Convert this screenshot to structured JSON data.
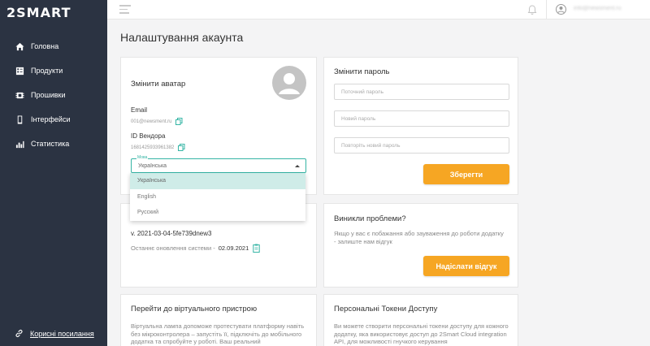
{
  "app": {
    "logo": "2SMART"
  },
  "sidebar": {
    "items": [
      {
        "label": "Головна",
        "icon": "home-icon"
      },
      {
        "label": "Продукти",
        "icon": "products-icon"
      },
      {
        "label": "Прошивки",
        "icon": "firmware-icon"
      },
      {
        "label": "Інтерфейси",
        "icon": "phone-icon"
      },
      {
        "label": "Статистика",
        "icon": "chart-icon"
      }
    ],
    "footer_link": "Корисні посилання"
  },
  "topbar": {
    "user_email": "info@newsment.ru"
  },
  "page": {
    "title": "Налаштування акаунта"
  },
  "account": {
    "avatar_label": "Змінити аватар",
    "email_label": "Email",
    "email_value": "001@newsment.ru",
    "vendor_label": "ID Вендора",
    "vendor_value": "1681425933961382",
    "language_legend": "Мова",
    "language_value": "Українська",
    "language_options": [
      "Українська",
      "English",
      "Русский"
    ]
  },
  "version": {
    "value": "v. 2021-03-04-5fe739dnew3",
    "update_label": "Останнє оновлення системи -",
    "update_date": "02.09.2021"
  },
  "password": {
    "title": "Змінити пароль",
    "current_placeholder": "Поточний пароль",
    "new_placeholder": "Новий пароль",
    "repeat_placeholder": "Повторіть новий пароль",
    "save_label": "Зберегти"
  },
  "problems": {
    "title": "Виникли проблеми?",
    "text": "Якщо у вас є побажання або зауваження до роботи додатку - залиште нам відгук",
    "button_label": "Надіслати відгук"
  },
  "virtual": {
    "title": "Перейти до віртуального пристрою",
    "text": "Віртуальна лампа допоможе протестувати платформу навіть без мікроконтролера – запустіть її, підключіть до мобільного додатка та спробуйте у роботі. Ваш реальний"
  },
  "tokens": {
    "title": "Персональні Токени Доступу",
    "text": "Ви можете створити персональні токени доступу для кожного додатку, яка використовує доступ до 2Smart Cloud integration API, для можливості гнучкого керування"
  },
  "colors": {
    "sidebar": "#2b3342",
    "accent": "#35b5a5",
    "button": "#f6a623"
  }
}
